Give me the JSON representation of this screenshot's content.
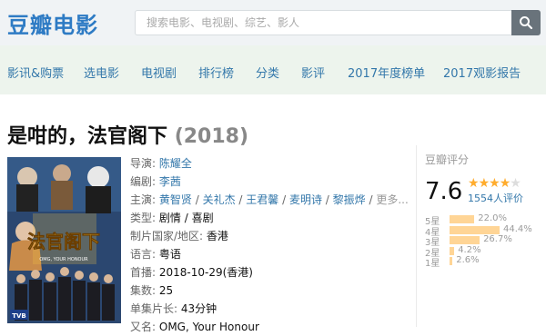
{
  "brand": {
    "logo_text": "豆瓣电影"
  },
  "search": {
    "placeholder": "搜索电影、电视剧、综艺、影人"
  },
  "nav": {
    "items": [
      "影讯&购票",
      "选电影",
      "电视剧",
      "排行榜",
      "分类",
      "影评",
      "2017年度榜单",
      "2017观影报告"
    ]
  },
  "title": {
    "name": "是咁的，法官阁下",
    "year": "(2018)"
  },
  "poster": {
    "text": "法官阁下",
    "subtitle": "OMG, YOUR HONOUR",
    "logo": "TVB"
  },
  "info": {
    "director_label": "导演:",
    "director": "陈耀全",
    "writer_label": "编剧:",
    "writer": "李茜",
    "cast_label": "主演:",
    "cast": [
      "黄智贤",
      "关礼杰",
      "王君馨",
      "麦明诗",
      "黎振烨"
    ],
    "cast_more": "更多...",
    "genre_label": "类型:",
    "genres": [
      "剧情",
      "喜剧"
    ],
    "region_label": "制片国家/地区:",
    "region": "香港",
    "language_label": "语言:",
    "language": "粤语",
    "premiere_label": "首播:",
    "premiere": "2018-10-29(香港)",
    "episodes_label": "集数:",
    "episodes": "25",
    "runtime_label": "单集片长:",
    "runtime": "43分钟",
    "aka_label": "又名:",
    "aka": "OMG, Your Honour"
  },
  "rating": {
    "title": "豆瓣评分",
    "score": "7.6",
    "stars": 4,
    "votes_text": "1554人评价",
    "accent_color": "#ffac2d",
    "bar_color": "#ffd596",
    "distribution": [
      {
        "label": "5星",
        "pct": 22.0,
        "pct_text": "22.0%"
      },
      {
        "label": "4星",
        "pct": 44.4,
        "pct_text": "44.4%"
      },
      {
        "label": "3星",
        "pct": 26.7,
        "pct_text": "26.7%"
      },
      {
        "label": "2星",
        "pct": 4.2,
        "pct_text": "4.2%"
      },
      {
        "label": "1星",
        "pct": 2.6,
        "pct_text": "2.6%"
      }
    ]
  }
}
